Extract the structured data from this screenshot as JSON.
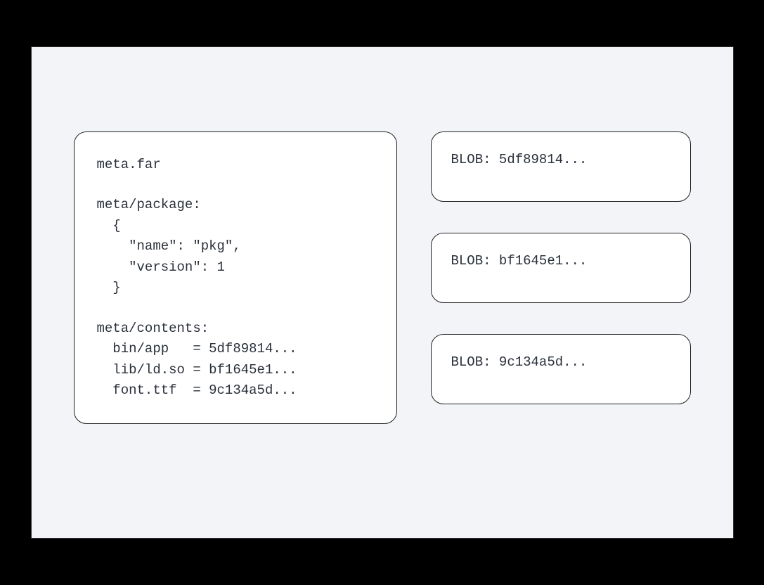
{
  "meta": {
    "title": "meta.far",
    "package_header": "meta/package:",
    "package_body": "  {\n    \"name\": \"pkg\",\n    \"version\": 1\n  }",
    "contents_header": "meta/contents:",
    "contents_body": "  bin/app   = 5df89814...\n  lib/ld.so = bf1645e1...\n  font.ttf  = 9c134a5d..."
  },
  "blobs": [
    {
      "label": "BLOB: 5df89814..."
    },
    {
      "label": "BLOB: bf1645e1..."
    },
    {
      "label": "BLOB: 9c134a5d..."
    }
  ]
}
